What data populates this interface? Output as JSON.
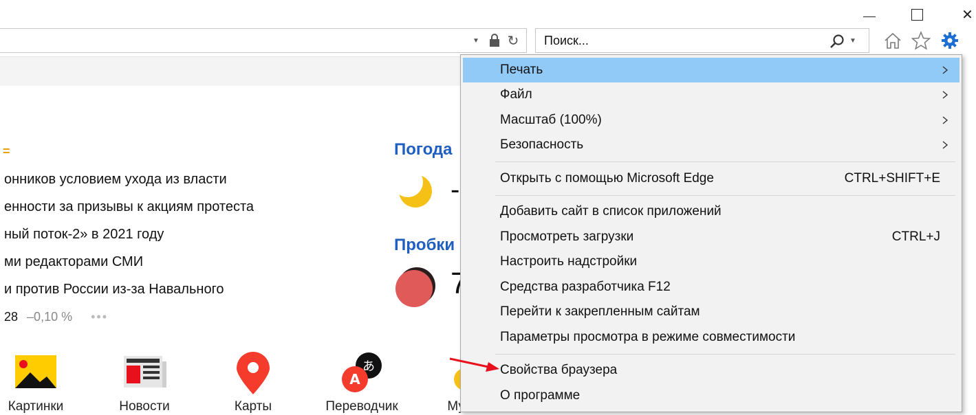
{
  "window": {
    "minimize": "",
    "maximize": "",
    "close": "✕"
  },
  "toolbar": {
    "search_placeholder": "Поиск...",
    "icons": [
      "chevron-down-icon",
      "lock-icon",
      "refresh-icon",
      "search-icon",
      "home-icon",
      "star-icon",
      "gear-icon"
    ]
  },
  "page": {
    "news": [
      "онников условием ухода из власти",
      "енности за призывы к акциям протеста",
      "ный поток-2» в 2021 году",
      "ми редакторами СМИ",
      "и против России из-за Навального"
    ],
    "news_marker": "=",
    "stock": {
      "value": "28",
      "change": "–0,10 %",
      "more": "•••"
    },
    "weather": {
      "title": "Погода",
      "temp": "-"
    },
    "traffic": {
      "title": "Пробки",
      "level": "7"
    },
    "services": [
      {
        "label": "Картинки",
        "icon": "images-icon"
      },
      {
        "label": "Новости",
        "icon": "news-icon"
      },
      {
        "label": "Карты",
        "icon": "map-pin-icon"
      },
      {
        "label": "Переводчик",
        "icon": "translate-icon"
      },
      {
        "label": "Музыка",
        "icon": "music-icon"
      }
    ]
  },
  "menu": {
    "items": [
      {
        "label": "Печать",
        "submenu": true,
        "highlighted": true
      },
      {
        "label": "Файл",
        "submenu": true
      },
      {
        "label": "Масштаб (100%)",
        "submenu": true
      },
      {
        "label": "Безопасность",
        "submenu": true
      },
      {
        "label": "Открыть с помощью Microsoft Edge",
        "shortcut": "CTRL+SHIFT+E"
      },
      {
        "label": "Добавить сайт в список приложений"
      },
      {
        "label": "Просмотреть загрузки",
        "shortcut": "CTRL+J"
      },
      {
        "label": "Настроить надстройки"
      },
      {
        "label": "Средства разработчика F12"
      },
      {
        "label": "Перейти к закрепленным сайтам"
      },
      {
        "label": "Параметры просмотра в режиме совместимости"
      },
      {
        "label": "Свойства браузера"
      },
      {
        "label": "О программе"
      }
    ]
  },
  "colors": {
    "menu_highlight": "#91c9f7",
    "widget_title": "#1f5fbf",
    "arrow": "#e8101c",
    "gear": "#1c6fd1"
  }
}
